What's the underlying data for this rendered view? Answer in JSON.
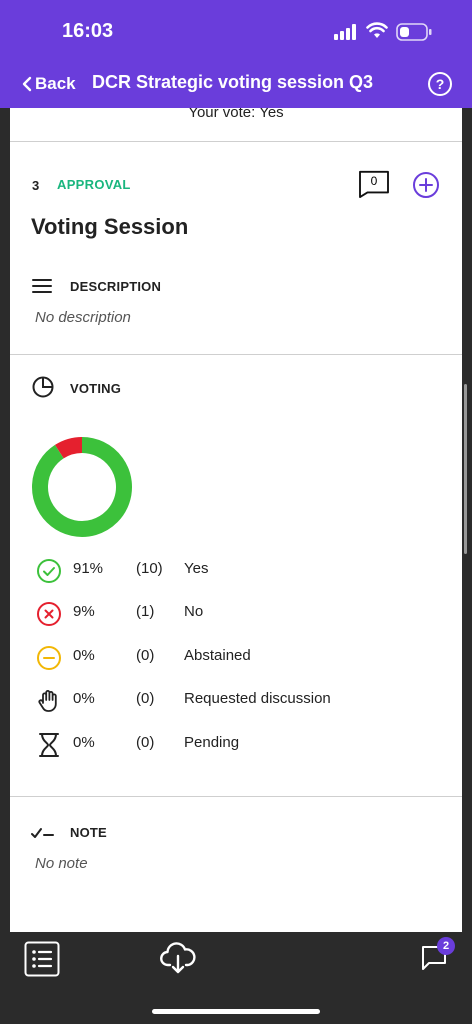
{
  "status_bar": {
    "time": "16:03"
  },
  "nav": {
    "back_label": "Back",
    "title": "DCR Strategic voting session Q3",
    "help_glyph": "?"
  },
  "previous": {
    "your_vote": "Your vote: Yes"
  },
  "item": {
    "number": "3",
    "status": "APPROVAL",
    "comment_count": "0",
    "title": "Voting Session"
  },
  "description": {
    "heading": "DESCRIPTION",
    "text": "No description"
  },
  "voting": {
    "heading": "VOTING",
    "rows": [
      {
        "pct": "91%",
        "count": "(10)",
        "label": "Yes",
        "icon": "check-circle-icon",
        "color": "#3cc13b"
      },
      {
        "pct": "9%",
        "count": "(1)",
        "label": "No",
        "icon": "x-circle-icon",
        "color": "#e5202e"
      },
      {
        "pct": "0%",
        "count": "(0)",
        "label": "Abstained",
        "icon": "minus-circle-icon",
        "color": "#f2b705"
      },
      {
        "pct": "0%",
        "count": "(0)",
        "label": "Requested discussion",
        "icon": "hand-icon",
        "color": "#222222"
      },
      {
        "pct": "0%",
        "count": "(0)",
        "label": "Pending",
        "icon": "hourglass-icon",
        "color": "#222222"
      }
    ]
  },
  "chart_data": {
    "type": "pie",
    "categories": [
      "Yes",
      "No",
      "Abstained",
      "Requested discussion",
      "Pending"
    ],
    "values": [
      10,
      1,
      0,
      0,
      0
    ],
    "colors": [
      "#3cc13b",
      "#e5202e",
      "#f2b705",
      "#222222",
      "#999999"
    ]
  },
  "note": {
    "heading": "NOTE",
    "text": "No note"
  },
  "tab_bar": {
    "badge": "2"
  },
  "colors": {
    "brand": "#6a3ddb",
    "approval": "#19b67e"
  }
}
